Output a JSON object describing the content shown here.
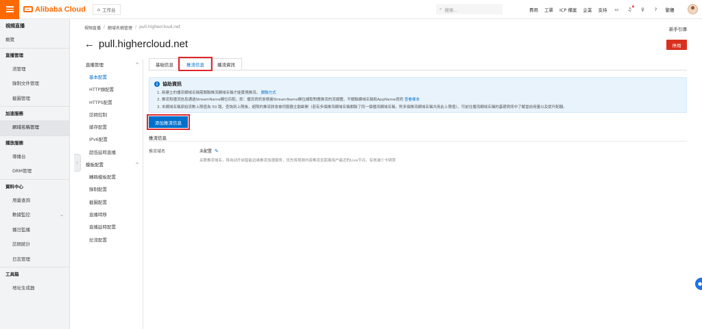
{
  "topbar": {
    "brand": "Alibaba Cloud",
    "workbench": "工作台",
    "search_placeholder": "搜索...",
    "nav": [
      "費用",
      "工單",
      "ICP 備案",
      "企業",
      "支持"
    ],
    "lang": "繁體"
  },
  "sidebar": {
    "title": "視頻直播",
    "overview": "概覽",
    "groups": [
      {
        "label": "直播管理",
        "items": [
          "流管理",
          "錄制文件管理",
          "截圖管理"
        ]
      },
      {
        "label": "加速服務",
        "items": [
          "網域名稱管理"
        ]
      },
      {
        "label": "播放服務",
        "items": [
          "導播台",
          "DRM管理"
        ]
      },
      {
        "label": "資料中心",
        "items": [
          "用量查詢",
          "數據監控",
          "播日監播",
          "訪問統計",
          "日志管理"
        ]
      },
      {
        "label": "工具箱",
        "items": [
          "地址生成器"
        ]
      }
    ],
    "active_item": "網域名稱管理"
  },
  "breadcrumb": [
    "視頻直播",
    "網域名稱管理",
    "pull.highercloud.net"
  ],
  "new_guide": "新手引導",
  "page_title": "pull.highercloud.net",
  "stop_button": "停用",
  "inner_nav": {
    "group1": "直播管理",
    "items1": [
      "基本配置",
      "HTTP頭配置",
      "HTTPS配置",
      "訪問控制",
      "緩存配置",
      "IPv6配置",
      "超低延時直播"
    ],
    "group2": "模板配置",
    "items2": [
      "轉碼模板配置",
      "錄制配置",
      "截圖配置",
      "直播時移",
      "直播延時配置",
      "拉流配置"
    ]
  },
  "tabs": [
    "基础信息",
    "推流信息",
    "播流資訊"
  ],
  "active_tab": "推流信息",
  "notice": {
    "title": "協助資訊",
    "lines": [
      "1. 新建立的播流網域名稱需關聯推流網域名稱才能實現推流。",
      "2. 推流和播流信息通過StreamName欄位匹配。即：播流資訊會根據StreamName欄位擷取對應推流的流媒體，不關聯網域名稱和AppName資訊",
      "3. 本網域名稱原始流數上限值為 50 路，查詢到上限後，超限的推流將會被伺服器主動斷開（若有多個推流網域名稱關聯了同一個播流網域名稱，則多個推流網域名稱共用此上限值）。可前往播流網域名稱的基礎資訊中了解當前用量以及提升配額。"
    ],
    "link1": "關聯方式",
    "link2": "查看樣本"
  },
  "add_button": "添加推流信息",
  "section_title": "推流信息",
  "field": {
    "label": "推流域名",
    "value": "未配置",
    "hint": "关联推流域名，将自动开启智能边缘推流加速服务，优先将视频内容推流至距离用户最近的Live节点，有效减少卡顿率"
  }
}
